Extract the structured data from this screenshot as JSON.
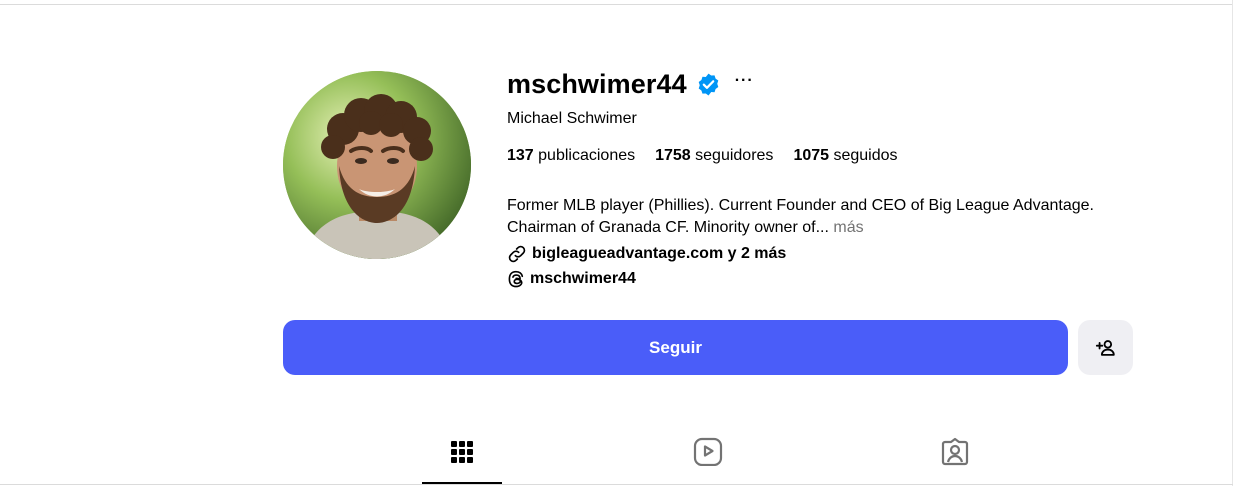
{
  "profile": {
    "username": "mschwimer44",
    "full_name": "Michael Schwimer",
    "stats": {
      "posts_count": "137",
      "posts_label": "publicaciones",
      "followers_count": "1758",
      "followers_label": "seguidores",
      "following_count": "1075",
      "following_label": "seguidos"
    },
    "bio_line1": "Former MLB player (Phillies). Current Founder and CEO of Big League Advantage.",
    "bio_line2": "Chairman of Granada CF. Minority owner of...",
    "bio_more": "más",
    "link_text": "bigleagueadvantage.com y 2 más",
    "threads_handle": "mschwimer44"
  },
  "actions": {
    "follow_label": "Seguir",
    "more_label": "···"
  },
  "icons": {
    "verified": "verified-badge-icon",
    "more": "more-options-icon",
    "link": "link-icon",
    "threads": "threads-icon",
    "suggest": "add-user-icon",
    "posts_tab": "grid-icon",
    "reels_tab": "reels-icon",
    "tagged_tab": "tagged-icon"
  },
  "colors": {
    "follow_button": "#4a5df9",
    "verified": "#0095f6",
    "muted_text": "#737373",
    "secondary_button": "#efeff3"
  }
}
